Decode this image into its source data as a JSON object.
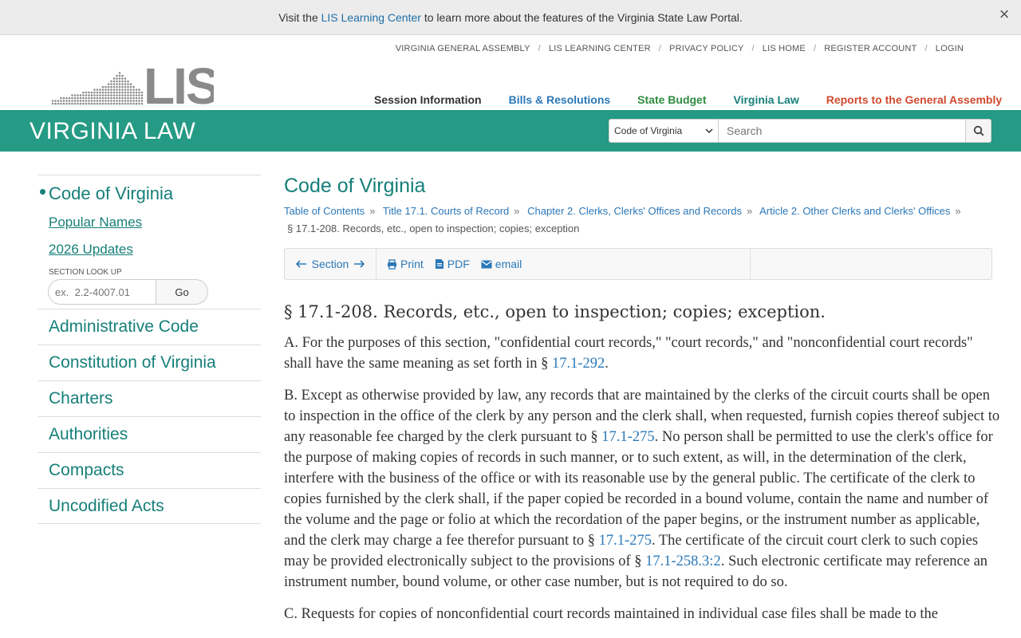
{
  "notice": {
    "prefix": "Visit the ",
    "link": "LIS Learning Center",
    "suffix": " to learn more about the features of the Virginia State Law Portal.",
    "close": "×"
  },
  "utility": [
    "VIRGINIA GENERAL ASSEMBLY",
    "LIS LEARNING CENTER",
    "PRIVACY POLICY",
    "LIS HOME",
    "REGISTER ACCOUNT",
    "LOGIN"
  ],
  "logo": {
    "text": "LIS"
  },
  "nav": {
    "session": "Session Information",
    "bills": "Bills & Resolutions",
    "budget": "State Budget",
    "law": "Virginia Law",
    "reports": "Reports to the General Assembly"
  },
  "band": {
    "title": "VIRGINIA LAW",
    "search_scope": "Code of Virginia",
    "search_placeholder": "Search"
  },
  "sidebar": {
    "active": "Code of Virginia",
    "sub": [
      "Popular Names",
      "2026 Updates"
    ],
    "lookup_label": "SECTION LOOK UP",
    "lookup_placeholder": "ex.  2.2-4007.01",
    "lookup_button": "Go",
    "items": [
      "Administrative Code",
      "Constitution of Virginia",
      "Charters",
      "Authorities",
      "Compacts",
      "Uncodified Acts"
    ]
  },
  "main": {
    "title": "Code of Virginia",
    "crumbs": [
      "Table of Contents",
      "Title 17.1. Courts of Record",
      "Chapter 2. Clerks, Clerks' Offices and Records",
      "Article 2. Other Clerks and Clerks' Offices"
    ],
    "current": "§ 17.1-208. Records, etc., open to inspection; copies; exception",
    "toolbar": {
      "section": "Section",
      "print": "Print",
      "pdf": "PDF",
      "email": "email"
    },
    "heading": "§ 17.1-208. Records, etc., open to inspection; copies; exception.",
    "para_a": {
      "t1": "A. For the purposes of this section, \"confidential court records,\" \"court records,\" and \"nonconfidential court records\" shall have the same meaning as set forth in § ",
      "l1": "17.1-292",
      "t2": "."
    },
    "para_b": {
      "t1": "B. Except as otherwise provided by law, any records that are maintained by the clerks of the circuit courts shall be open to inspection in the office of the clerk by any person and the clerk shall, when requested, furnish copies thereof subject to any reasonable fee charged by the clerk pursuant to § ",
      "l1": "17.1-275",
      "t2": ". No person shall be permitted to use the clerk's office for the purpose of making copies of records in such manner, or to such extent, as will, in the determination of the clerk, interfere with the business of the office or with its reasonable use by the general public. The certificate of the clerk to copies furnished by the clerk shall, if the paper copied be recorded in a bound volume, contain the name and number of the volume and the page or folio at which the recordation of the paper begins, or the instrument number as applicable, and the clerk may charge a fee therefor pursuant to § ",
      "l2": "17.1-275",
      "t3": ". The certificate of the circuit court clerk to such copies may be provided electronically subject to the provisions of § ",
      "l3": "17.1-258.3:2",
      "t4": ". Such electronic certificate may reference an instrument number, bound volume, or other case number, but is not required to do so."
    },
    "para_c": "C. Requests for copies of nonconfidential court records maintained in individual case files shall be made to the"
  },
  "colors": {
    "teal_band": "#259a84",
    "teal_text": "#167f79",
    "link_blue": "#2b78b8",
    "reports_red": "#d04a2f",
    "budget_green": "#2e8b3e"
  }
}
